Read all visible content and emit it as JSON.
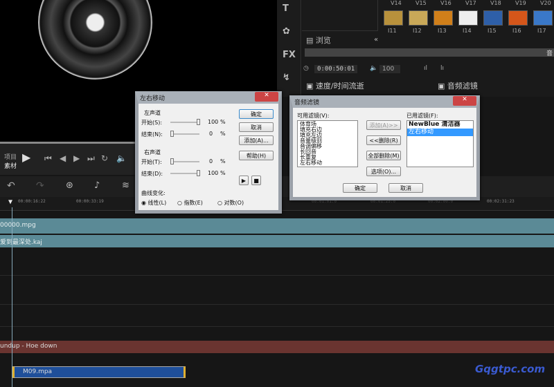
{
  "player": {
    "project_label": "项目",
    "clip_label": "素材"
  },
  "library": {
    "top_labels": [
      "V14",
      "V15",
      "V16",
      "V17",
      "V18",
      "V19",
      "V20"
    ],
    "thumbs": [
      "I11",
      "I12",
      "I13",
      "I14",
      "I15",
      "I16",
      "I17"
    ],
    "browse": "浏览",
    "bar_label": "音",
    "timecode": "0:00:50:01",
    "volume": "100",
    "speed_label": "速度/时间流逝",
    "audio_filter_label": "音频滤镜"
  },
  "ruler": [
    "00:00:16:22",
    "00:00:33:19",
    "00:01:01:0",
    "00:01:25:0",
    "00:02:00:0",
    "00:02:31:23"
  ],
  "tracks": {
    "video": "00000.mpg",
    "overlay": "爱到最深处.kaj",
    "music": "undup - Hoe down",
    "audio": "M09.mpa"
  },
  "pan_dialog": {
    "title": "左右移动",
    "left_channel": "左声道",
    "right_channel": "右声道",
    "start_s": "开始(S):",
    "end_n": "结束(N):",
    "start_t": "开始(T):",
    "end_d": "结束(D):",
    "left_start": "100",
    "left_end": "0",
    "right_start": "0",
    "right_end": "100",
    "pct": "%",
    "ok": "确定",
    "cancel": "取消",
    "add": "添加(A)...",
    "help": "帮助(H)",
    "curve": "曲线变化:",
    "linear": "线性(L)",
    "exp": "指数(E)",
    "log": "对数(O)",
    "left_start_level": 1,
    "left_end_level": 0,
    "right_start_level": 0,
    "right_end_level": 1
  },
  "filter_dialog": {
    "title": "音频滤镜",
    "available_label": "可用滤镜(V):",
    "applied_label": "已用滤镜(F):",
    "available": [
      "体育场",
      "填充右边",
      "填充左边",
      "音量级别",
      "音调偏移",
      "长回音",
      "长重复",
      "左右移动"
    ],
    "applied": [
      "NewBlue 清洁器",
      "左右移动"
    ],
    "add": "添加(A)>>",
    "remove": "<<删除(R)",
    "remove_all": "全部删除(M)",
    "options": "选项(O)...",
    "ok": "确定",
    "cancel": "取消"
  },
  "watermark": "Gqgtpc.com"
}
